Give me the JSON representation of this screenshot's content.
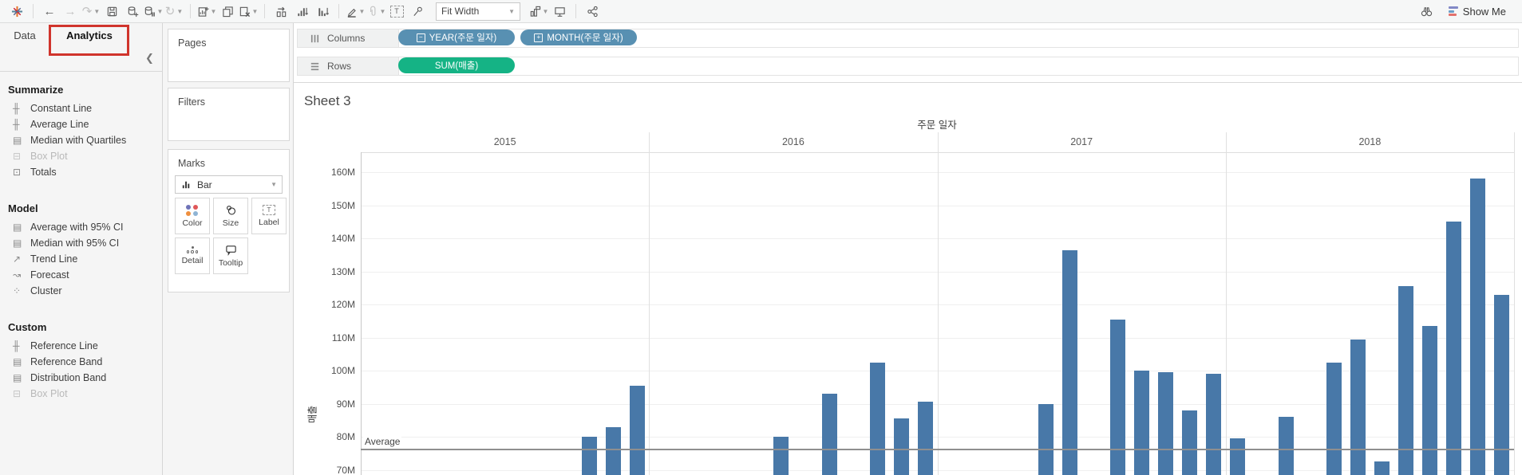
{
  "toolbar": {
    "fit_mode": "Fit Width",
    "show_me": "Show Me",
    "items_left": [
      {
        "name": "tableau-logo"
      },
      {
        "sep": true
      },
      {
        "name": "undo"
      },
      {
        "name": "redo",
        "disabled": true
      },
      {
        "name": "replay",
        "disabled": true,
        "caret": true
      },
      {
        "name": "save"
      },
      {
        "name": "add-data-source"
      },
      {
        "name": "pause-auto-updates",
        "caret": true
      },
      {
        "name": "refresh-data",
        "disabled": true,
        "caret": true
      },
      {
        "sep": true
      },
      {
        "name": "new-worksheet",
        "caret": true
      },
      {
        "name": "duplicate-sheet"
      },
      {
        "name": "clear-sheet",
        "caret": true
      },
      {
        "sep": true
      },
      {
        "name": "swap-rows-columns"
      },
      {
        "name": "sort-ascending"
      },
      {
        "name": "sort-descending"
      },
      {
        "sep": true
      },
      {
        "name": "highlight",
        "caret": true
      },
      {
        "name": "group-members",
        "disabled": true,
        "caret": true
      },
      {
        "name": "text-label",
        "disabled": true
      },
      {
        "name": "fix-axes"
      }
    ],
    "items_right": [
      {
        "name": "show-mark-labels",
        "caret": true
      },
      {
        "name": "presentation-mode"
      },
      {
        "sep": true
      },
      {
        "name": "share"
      }
    ]
  },
  "left_panel": {
    "tabs": [
      {
        "label": "Data",
        "active": false
      },
      {
        "label": "Analytics",
        "active": true
      }
    ],
    "sections": [
      {
        "title": "Summarize",
        "items": [
          {
            "label": "Constant Line",
            "icon": "line",
            "disabled": false
          },
          {
            "label": "Average Line",
            "icon": "line",
            "disabled": false
          },
          {
            "label": "Median with Quartiles",
            "icon": "band",
            "disabled": false
          },
          {
            "label": "Box Plot",
            "icon": "box",
            "disabled": true
          },
          {
            "label": "Totals",
            "icon": "totals",
            "disabled": false
          }
        ]
      },
      {
        "title": "Model",
        "items": [
          {
            "label": "Average with 95% CI",
            "icon": "band",
            "disabled": false
          },
          {
            "label": "Median with 95% CI",
            "icon": "band",
            "disabled": false
          },
          {
            "label": "Trend Line",
            "icon": "trend",
            "disabled": false
          },
          {
            "label": "Forecast",
            "icon": "forecast",
            "disabled": false
          },
          {
            "label": "Cluster",
            "icon": "cluster",
            "disabled": false
          }
        ]
      },
      {
        "title": "Custom",
        "items": [
          {
            "label": "Reference Line",
            "icon": "line",
            "disabled": false
          },
          {
            "label": "Reference Band",
            "icon": "band",
            "disabled": false
          },
          {
            "label": "Distribution Band",
            "icon": "band",
            "disabled": false
          },
          {
            "label": "Box Plot",
            "icon": "box",
            "disabled": true
          }
        ]
      }
    ]
  },
  "cards": {
    "pages": {
      "title": "Pages"
    },
    "filters": {
      "title": "Filters"
    },
    "marks": {
      "title": "Marks",
      "mark_type": "Bar",
      "buttons": [
        {
          "name": "color",
          "label": "Color"
        },
        {
          "name": "size",
          "label": "Size"
        },
        {
          "name": "label",
          "label": "Label"
        },
        {
          "name": "detail",
          "label": "Detail"
        },
        {
          "name": "tooltip",
          "label": "Tooltip"
        }
      ]
    }
  },
  "shelves": {
    "columns": {
      "label": "Columns",
      "pills": [
        {
          "label": "YEAR(주문 일자)",
          "modifier": "minus"
        },
        {
          "label": "MONTH(주문 일자)",
          "modifier": "plus"
        }
      ]
    },
    "rows": {
      "label": "Rows",
      "pills": [
        {
          "label": "SUM(매출)"
        }
      ]
    }
  },
  "sheet": {
    "title": "Sheet 3"
  },
  "chart_data": {
    "type": "bar",
    "title": "주문 일자",
    "ylabel": "매출",
    "y_ticks": [
      "160M",
      "150M",
      "140M",
      "130M",
      "120M",
      "110M",
      "100M",
      "90M",
      "80M",
      "70M"
    ],
    "y_axis": {
      "visible_min": 70,
      "visible_max": 160,
      "tick_step": 10,
      "unit": "M"
    },
    "categories_years": [
      "2015",
      "2016",
      "2017",
      "2018"
    ],
    "reference_line": {
      "label": "Average",
      "value": 76.5
    },
    "series": [
      {
        "year": "2015",
        "points": [
          {
            "month": 10,
            "value": 80
          },
          {
            "month": 11,
            "value": 83
          },
          {
            "month": 12,
            "value": 95.5
          }
        ]
      },
      {
        "year": "2016",
        "points": [
          {
            "month": 6,
            "value": 80
          },
          {
            "month": 8,
            "value": 93
          },
          {
            "month": 10,
            "value": 102.5
          },
          {
            "month": 11,
            "value": 85.5
          },
          {
            "month": 12,
            "value": 90.5
          }
        ]
      },
      {
        "year": "2017",
        "points": [
          {
            "month": 5,
            "value": 90
          },
          {
            "month": 6,
            "value": 136.5
          },
          {
            "month": 8,
            "value": 115.5
          },
          {
            "month": 9,
            "value": 100
          },
          {
            "month": 10,
            "value": 99.5
          },
          {
            "month": 11,
            "value": 88
          },
          {
            "month": 12,
            "value": 99
          }
        ]
      },
      {
        "year": "2018",
        "points": [
          {
            "month": 1,
            "value": 79.5
          },
          {
            "month": 3,
            "value": 86
          },
          {
            "month": 5,
            "value": 102.5
          },
          {
            "month": 6,
            "value": 109.5
          },
          {
            "month": 7,
            "value": 72.5
          },
          {
            "month": 8,
            "value": 125.5
          },
          {
            "month": 9,
            "value": 113.5
          },
          {
            "month": 10,
            "value": 145
          },
          {
            "month": 11,
            "value": 158
          },
          {
            "month": 12,
            "value": 123
          }
        ]
      }
    ],
    "bar_color": "#4878A8"
  },
  "colors": {
    "bar": "#4878A8",
    "pill_blue": "#5890B2",
    "pill_green": "#15B385",
    "annotation_red": "#D0342C",
    "color_button_dots": [
      "#6F73B8",
      "#E05759",
      "#EF8F3E",
      "#8FB4D4"
    ],
    "showme_bars": [
      "#8289C6",
      "#6A9EC9",
      "#E2726E"
    ]
  }
}
